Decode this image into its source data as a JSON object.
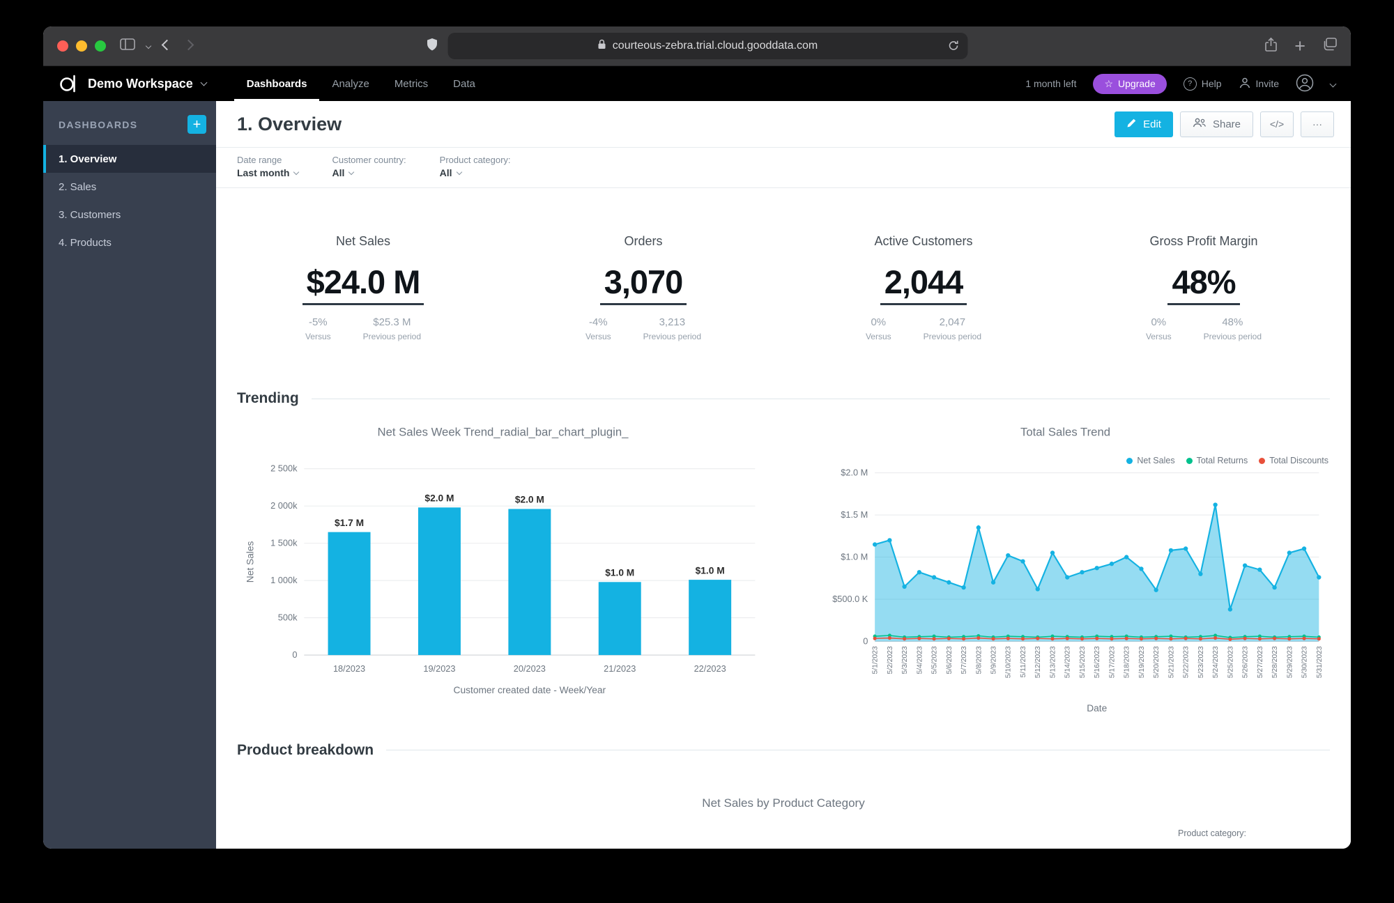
{
  "browser": {
    "url": "courteous-zebra.trial.cloud.gooddata.com"
  },
  "icons": {
    "plus": "+",
    "star": "☆",
    "help": "?"
  },
  "app_header": {
    "workspace": "Demo Workspace",
    "nav": [
      {
        "label": "Dashboards",
        "active": true
      },
      {
        "label": "Analyze"
      },
      {
        "label": "Metrics"
      },
      {
        "label": "Data"
      }
    ],
    "trial_text": "1 month left",
    "upgrade_label": "Upgrade",
    "help_label": "Help",
    "invite_label": "Invite"
  },
  "sidebar": {
    "title": "DASHBOARDS",
    "items": [
      {
        "label": "1. Overview",
        "active": true
      },
      {
        "label": "2. Sales"
      },
      {
        "label": "3. Customers"
      },
      {
        "label": "4. Products"
      }
    ]
  },
  "page": {
    "title": "1. Overview",
    "edit_label": "Edit",
    "share_label": "Share",
    "embed_label": "</>",
    "more_label": "···"
  },
  "filters": [
    {
      "caption": "Date range",
      "value": "Last month"
    },
    {
      "caption": "Customer country:",
      "value": "All"
    },
    {
      "caption": "Product category:",
      "value": "All"
    }
  ],
  "kpi_labels": {
    "versus": "Versus",
    "previous": "Previous period"
  },
  "kpis": [
    {
      "title": "Net Sales",
      "value": "$24.0 M",
      "change": "-5%",
      "previous": "$25.3 M"
    },
    {
      "title": "Orders",
      "value": "3,070",
      "change": "-4%",
      "previous": "3,213"
    },
    {
      "title": "Active Customers",
      "value": "2,044",
      "change": "0%",
      "previous": "2,047"
    },
    {
      "title": "Gross Profit Margin",
      "value": "48%",
      "change": "0%",
      "previous": "48%"
    }
  ],
  "sections": {
    "trending": "Trending",
    "product_breakdown": "Product breakdown",
    "product_chart_title": "Net Sales by Product Category",
    "product_legend_caption": "Product category:"
  },
  "colors": {
    "accent": "#14b2e2",
    "upgrade_purple": "#9a4fdd",
    "returns_green": "#00c18d",
    "discounts_red": "#e8503a",
    "sidebar_bg": "#38404f"
  },
  "chart_data": [
    {
      "type": "bar",
      "title": "Net Sales Week Trend_radial_bar_chart_plugin_",
      "categories": [
        "18/2023",
        "19/2023",
        "20/2023",
        "21/2023",
        "22/2023"
      ],
      "values": [
        1650000,
        1980000,
        1960000,
        980000,
        1010000
      ],
      "value_labels": [
        "$1.7 M",
        "$2.0 M",
        "$2.0 M",
        "$1.0 M",
        "$1.0 M"
      ],
      "xlabel": "Customer created date - Week/Year",
      "ylabel": "Net Sales",
      "yticks": [
        "0",
        "500k",
        "1 000k",
        "1 500k",
        "2 000k",
        "2 500k"
      ],
      "ylim": [
        0,
        2500000
      ],
      "grid": true,
      "bar_color": "#14b2e2"
    },
    {
      "type": "area",
      "title": "Total Sales Trend",
      "xlabel": "Date",
      "yticks": [
        "0",
        "$500.0 K",
        "$1.0 M",
        "$1.5 M",
        "$2.0 M"
      ],
      "ylim": [
        0,
        2000000
      ],
      "grid": true,
      "legend_position": "top-right",
      "x": [
        "5/1/2023",
        "5/2/2023",
        "5/3/2023",
        "5/4/2023",
        "5/5/2023",
        "5/6/2023",
        "5/7/2023",
        "5/8/2023",
        "5/9/2023",
        "5/10/2023",
        "5/11/2023",
        "5/12/2023",
        "5/13/2023",
        "5/14/2023",
        "5/15/2023",
        "5/16/2023",
        "5/17/2023",
        "5/18/2023",
        "5/19/2023",
        "5/20/2023",
        "5/21/2023",
        "5/22/2023",
        "5/23/2023",
        "5/24/2023",
        "5/25/2023",
        "5/26/2023",
        "5/27/2023",
        "5/28/2023",
        "5/29/2023",
        "5/30/2023",
        "5/31/2023"
      ],
      "series": [
        {
          "name": "Net Sales",
          "color": "#14b2e2",
          "type": "area",
          "values": [
            1150000,
            1200000,
            650000,
            820000,
            760000,
            700000,
            640000,
            1350000,
            700000,
            1020000,
            950000,
            620000,
            1050000,
            760000,
            820000,
            870000,
            920000,
            1000000,
            860000,
            610000,
            1080000,
            1100000,
            800000,
            1620000,
            380000,
            900000,
            850000,
            640000,
            1050000,
            1100000,
            760000
          ]
        },
        {
          "name": "Total Returns",
          "color": "#00c18d",
          "type": "line",
          "values": [
            60000,
            70000,
            50000,
            55000,
            60000,
            50000,
            55000,
            65000,
            50000,
            60000,
            55000,
            50000,
            60000,
            55000,
            50000,
            60000,
            55000,
            60000,
            50000,
            55000,
            60000,
            50000,
            55000,
            70000,
            45000,
            55000,
            60000,
            50000,
            55000,
            60000,
            50000
          ]
        },
        {
          "name": "Total Discounts",
          "color": "#e8503a",
          "type": "line",
          "values": [
            35000,
            40000,
            30000,
            35000,
            30000,
            35000,
            30000,
            40000,
            30000,
            35000,
            30000,
            35000,
            30000,
            35000,
            30000,
            35000,
            30000,
            35000,
            30000,
            35000,
            30000,
            35000,
            30000,
            40000,
            25000,
            35000,
            30000,
            35000,
            30000,
            35000,
            30000
          ]
        }
      ]
    }
  ]
}
